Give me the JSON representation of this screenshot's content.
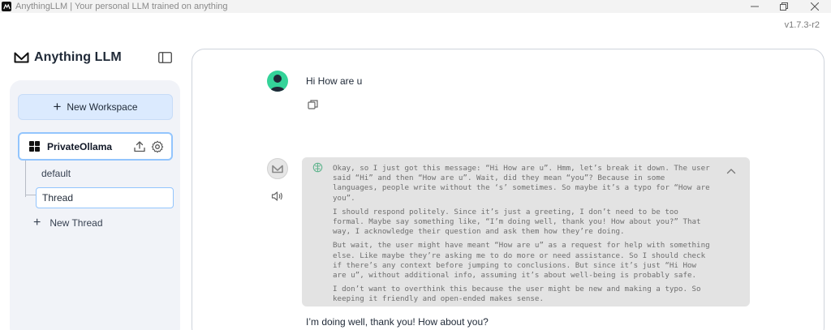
{
  "window": {
    "title": "AnythingLLM | Your personal LLM trained on anything",
    "controls": [
      "minimize",
      "restore",
      "close"
    ]
  },
  "version": "v1.7.3-r2",
  "sidebar": {
    "logo_text": "Anything LLM",
    "new_workspace_label": "New Workspace",
    "workspace": {
      "name": "PrivateOllama",
      "threads": [
        {
          "label": "default",
          "active": false
        },
        {
          "label": "Thread",
          "active": true
        }
      ],
      "new_thread_label": "New Thread"
    }
  },
  "chat": {
    "user_message": "Hi How are u",
    "thinking_paragraphs": [
      "Okay, so I just got this message: “Hi How are u”. Hmm, let’s break it down. The user said “Hi” and then “How are u”. Wait, did they mean “you”? Because in some languages, people write without the ‘s’ sometimes. So maybe it’s a typo for “How are you”.",
      "I should respond politely. Since it’s just a greeting, I don’t need to be too formal. Maybe say something like, “I’m doing well, thank you! How about you?” That way, I acknowledge their question and ask them how they’re doing.",
      "But wait, the user might have meant “How are u” as a request for help with something else. Like maybe they’re asking me to do more or need assistance. So I should check if there’s any context before jumping to conclusions. But since it’s just “Hi How are u”, without additional info, assuming it’s about well-being is probably safe.",
      "I don’t want to overthink this because the user might be new and making a typo. So keeping it friendly and open-ended makes sense."
    ],
    "assistant_reply": "I’m doing well, thank you! How about you?"
  },
  "colors": {
    "accent_light": "#dbeafe",
    "accent_border": "#93c5fd",
    "user_avatar": "#34d399",
    "thinking_bg": "#e3e3e3"
  }
}
